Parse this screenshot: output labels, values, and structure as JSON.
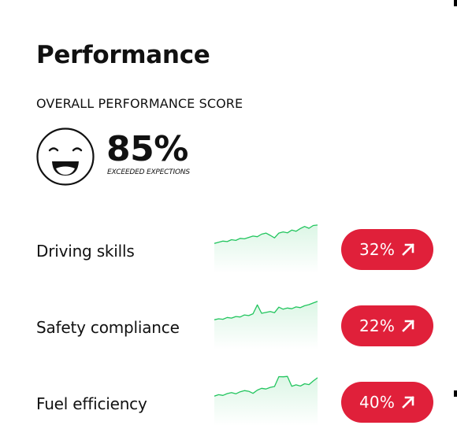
{
  "header": {
    "title": "Performance",
    "section_label": "OVERALL PERFORMANCE SCORE"
  },
  "overall": {
    "score": "85%",
    "caption": "EXCEEDED EXPECTIONS",
    "face_icon": "smiley-face-icon"
  },
  "metrics": [
    {
      "label": "Driving skills",
      "value": "32%",
      "trend_icon": "arrow-up-right-icon",
      "sparkline": [
        2,
        2.5,
        3,
        2.8,
        3.6,
        3.3,
        4.2,
        4,
        4.6,
        5.2,
        4.9,
        6,
        6.5,
        5.5,
        4.4,
        6.5,
        7,
        6.6,
        7.8,
        7.3,
        8.5,
        9.4,
        8.6,
        9.8,
        10
      ]
    },
    {
      "label": "Safety compliance",
      "value": "22%",
      "trend_icon": "arrow-up-right-icon",
      "sparkline": [
        2,
        2.4,
        2.2,
        3,
        2.7,
        3.4,
        3.2,
        4.1,
        3.8,
        4.6,
        8.5,
        4.8,
        5.2,
        5.6,
        5.1,
        7.5,
        6.6,
        7.1,
        6.8,
        7.6,
        7.3,
        8.1,
        8.6,
        9.3,
        10
      ]
    },
    {
      "label": "Fuel efficiency",
      "value": "40%",
      "trend_icon": "arrow-up-right-icon",
      "sparkline": [
        2,
        2.6,
        2.3,
        3.1,
        3.5,
        3,
        3.9,
        4.4,
        4.1,
        3.2,
        4.6,
        5.4,
        5.1,
        5.8,
        6.2,
        10.5,
        10.4,
        10.6,
        6.3,
        6.9,
        6.4,
        7.4,
        7,
        8.6,
        10
      ]
    }
  ],
  "colors": {
    "accent": "#e0203a",
    "sparkline": "#22c55e",
    "sparkline_fill": "#22c55e",
    "text": "#111111"
  }
}
